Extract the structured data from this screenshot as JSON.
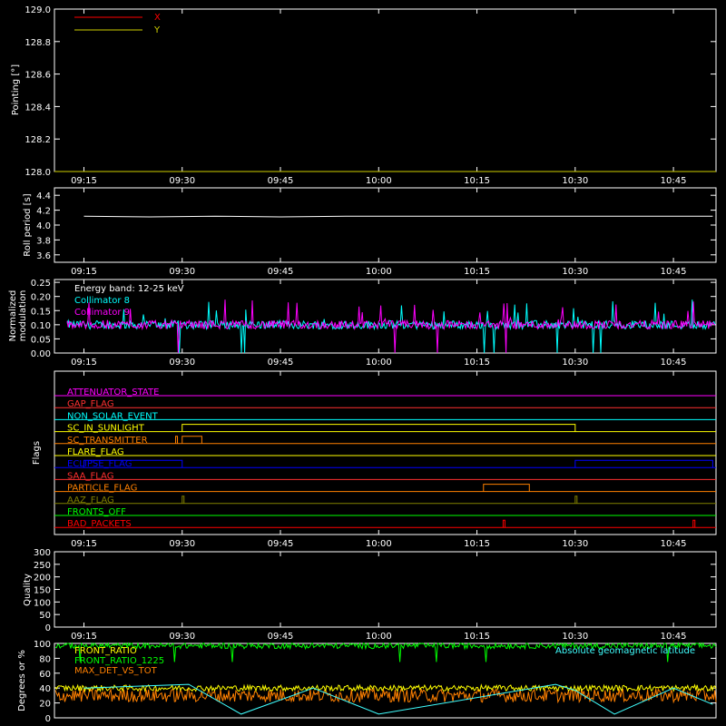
{
  "chart_data": [
    {
      "type": "line",
      "ylabel": "Pointing [°]",
      "ylim": [
        128.0,
        129.0
      ],
      "yticks": [
        "128.0",
        "128.2",
        "128.4",
        "128.6",
        "128.8",
        "129.0"
      ],
      "xticks": [
        "09:15",
        "09:30",
        "09:45",
        "10:00",
        "10:15",
        "10:30",
        "10:45"
      ],
      "legend": [
        {
          "name": "X",
          "color": "#ff0000"
        },
        {
          "name": "Y",
          "color": "#d0d000"
        }
      ],
      "legend_placement": "top-left"
    },
    {
      "type": "line",
      "ylabel": "Roll period [s]",
      "ylim": [
        3.5,
        4.5
      ],
      "yticks": [
        "3.6",
        "3.8",
        "4.0",
        "4.2",
        "4.4"
      ],
      "xticks": [
        "09:15",
        "09:30",
        "09:45",
        "10:00",
        "10:15",
        "10:30",
        "10:45"
      ],
      "series": [
        {
          "color": "#ffffff",
          "x": [
            "09:15",
            "09:25",
            "09:35",
            "09:45",
            "09:55",
            "10:00",
            "10:15",
            "10:30",
            "10:45",
            "10:51"
          ],
          "values": [
            4.12,
            4.11,
            4.12,
            4.11,
            4.12,
            4.12,
            4.12,
            4.12,
            4.12,
            4.12
          ]
        }
      ]
    },
    {
      "type": "line",
      "ylabel_lines": [
        "Normalized",
        "modulation"
      ],
      "ylim": [
        0.0,
        0.26
      ],
      "yticks": [
        "0.00",
        "0.05",
        "0.10",
        "0.15",
        "0.20",
        "0.25"
      ],
      "xticks": [
        "09:15",
        "09:30",
        "09:45",
        "10:00",
        "10:15",
        "10:30",
        "10:45"
      ],
      "annotation": "Energy band: 12-25 keV",
      "series": [
        {
          "name": "Collimator 8",
          "color": "#00ffff",
          "typical": 0.1
        },
        {
          "name": "Collimator 9",
          "color": "#ff00ff",
          "typical": 0.1
        }
      ]
    },
    {
      "type": "line",
      "ylabel": "Flags",
      "xticks": [
        "09:15",
        "09:30",
        "09:45",
        "10:00",
        "10:15",
        "10:30",
        "10:45"
      ],
      "flags": [
        {
          "name": "ATTENUATOR_STATE",
          "color": "#ff00ff",
          "segments": []
        },
        {
          "name": "GAP_FLAG",
          "color": "#ff3030",
          "segments": []
        },
        {
          "name": "NON_SOLAR_EVENT",
          "color": "#00ffff",
          "segments": []
        },
        {
          "name": "SC_IN_SUNLIGHT",
          "color": "#ffff00",
          "segments": [
            [
              "09:30",
              "10:30"
            ]
          ]
        },
        {
          "name": "SC_TRANSMITTER",
          "color": "#ff8000",
          "segments": [
            [
              "09:29",
              "09:29"
            ],
            [
              "09:30",
              "09:33"
            ]
          ]
        },
        {
          "name": "FLARE_FLAG",
          "color": "#ffff00",
          "segments": []
        },
        {
          "name": "ECLIPSE_FLAG",
          "color": "#0000ff",
          "segments": [
            [
              "09:15",
              "09:30"
            ],
            [
              "10:30",
              "10:51"
            ]
          ]
        },
        {
          "name": "SAA_FLAG",
          "color": "#ff3030",
          "segments": []
        },
        {
          "name": "PARTICLE_FLAG",
          "color": "#ff8000",
          "segments": [
            [
              "10:16",
              "10:23"
            ]
          ]
        },
        {
          "name": "AAZ_FLAG",
          "color": "#808000",
          "segments": [
            [
              "09:30",
              "09:30"
            ],
            [
              "10:30",
              "10:30"
            ]
          ]
        },
        {
          "name": "FRONTS_OFF",
          "color": "#00ff00",
          "segments": []
        },
        {
          "name": "BAD_PACKETS",
          "color": "#ff0000",
          "segments": [
            [
              "10:19",
              "10:19"
            ],
            [
              "10:48",
              "10:48"
            ]
          ]
        }
      ]
    },
    {
      "type": "line",
      "ylabel": "Quality",
      "ylim": [
        0,
        300
      ],
      "yticks": [
        "0",
        "50",
        "100",
        "150",
        "200",
        "250",
        "300"
      ],
      "xticks": [
        "09:15",
        "09:30",
        "09:45",
        "10:00",
        "10:15",
        "10:30",
        "10:45"
      ],
      "series": []
    },
    {
      "type": "line",
      "ylabel": "Degrees or %",
      "ylim": [
        0,
        100
      ],
      "yticks": [
        "0",
        "20",
        "40",
        "60",
        "80",
        "100"
      ],
      "legend_placement": "top-left",
      "series": [
        {
          "name": "FRONT_RATIO",
          "color": "#ffff00",
          "typical": 40
        },
        {
          "name": "FRONT_RATIO_1225",
          "color": "#00ff00",
          "typical": 97
        },
        {
          "name": "MAX_DET_VS_TOT",
          "color": "#ff8000",
          "typical": 30
        },
        {
          "name": "Absolute geomagnetic latitude",
          "color": "#40ffff",
          "x": [
            "09:15",
            "09:31",
            "09:39",
            "09:50",
            "10:00",
            "10:27",
            "10:30",
            "10:36",
            "10:45",
            "10:51"
          ],
          "values": [
            40,
            45,
            5,
            40,
            5,
            45,
            37,
            5,
            40,
            18
          ]
        }
      ]
    }
  ]
}
